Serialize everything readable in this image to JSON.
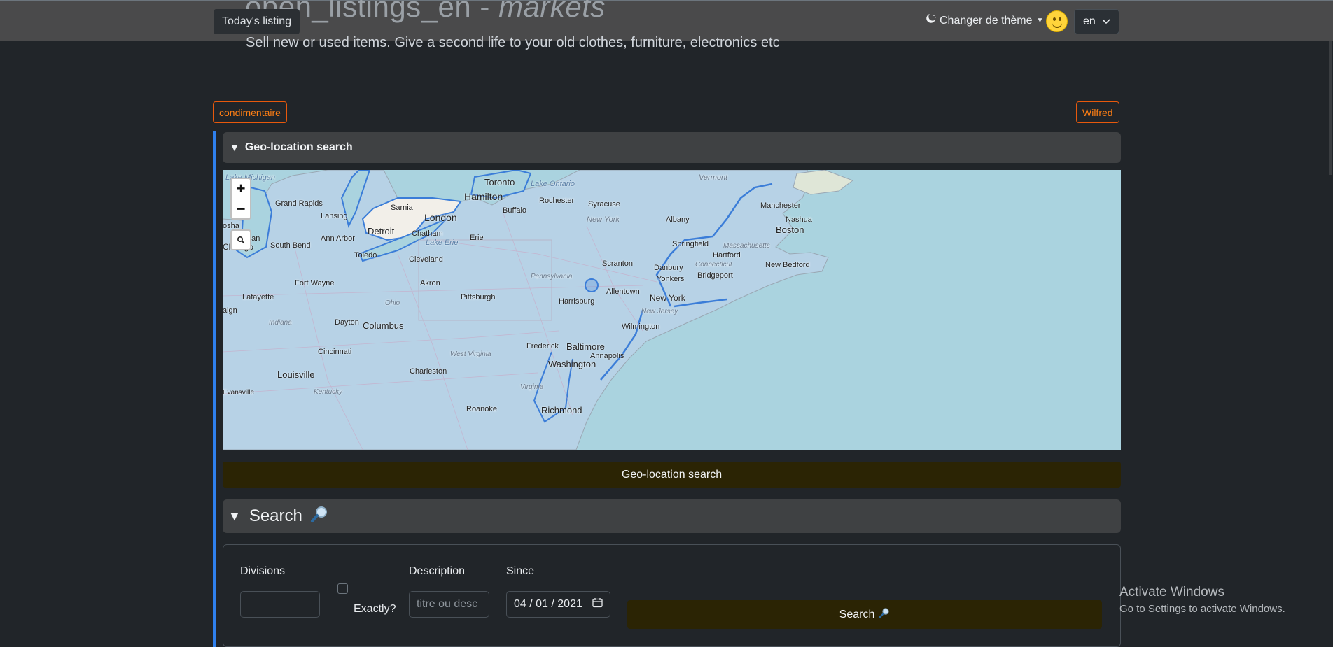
{
  "header": {
    "site_title_main": "open_listings_en - ",
    "site_title_italic": "markets",
    "todays_listing": "Today's listing",
    "theme_switch_label": "Changer de thème",
    "language": "en",
    "subtitle": "Sell new or used items. Give a second life to your old clothes, furniture, electronics etc"
  },
  "tags": {
    "left": "condimentaire",
    "right": "Wilfred"
  },
  "geo": {
    "section_title": "Geo-location search",
    "button_label": "Geo-location search",
    "map": {
      "zoom_in": "+",
      "zoom_out": "−",
      "labels": {
        "lake_michigan": "Lake Michigan",
        "toronto": "Toronto",
        "lake_ontario": "Lake Ontario",
        "vermont": "Vermont",
        "hamilton": "Hamilton",
        "rochester": "Rochester",
        "syracuse": "Syracuse",
        "manchester": "Manchester",
        "nashua": "Nashua",
        "grand_rapids": "Grand Rapids",
        "sarnia": "Sarnia",
        "lansing": "Lansing",
        "london": "London",
        "buffalo": "Buffalo",
        "new_york_state": "New York",
        "albany": "Albany",
        "boston": "Boston",
        "detroit": "Detroit",
        "chatham": "Chatham",
        "ann_arbor": "Ann Arbor",
        "erie": "Erie",
        "lake_erie": "Lake Erie",
        "springfield": "Springfield",
        "massachusetts": "Massachusetts",
        "chicago": "Chicago",
        "south_bend": "South Bend",
        "toledo": "Toledo",
        "cleveland": "Cleveland",
        "scranton": "Scranton",
        "hartford": "Hartford",
        "connecticut": "Connecticut",
        "new_bedford": "New Bedford",
        "danbury": "Danbury",
        "pennsylvania": "Pennsylvania",
        "fort_wayne": "Fort Wayne",
        "akron": "Akron",
        "yonkers": "Yonkers",
        "bridgeport": "Bridgeport",
        "lafayette": "Lafayette",
        "ohio": "Ohio",
        "pittsburgh": "Pittsburgh",
        "harrisburg": "Harrisburg",
        "allentown": "Allentown",
        "new_york_city": "New York",
        "dayton": "Dayton",
        "columbus": "Columbus",
        "indiana": "Indiana",
        "new_jersey": "New Jersey",
        "wilmington": "Wilmington",
        "frederick": "Frederick",
        "baltimore": "Baltimore",
        "cincinnati": "Cincinnati",
        "west_virginia": "West Virginia",
        "annapolis": "Annapolis",
        "washington": "Washington",
        "louisville": "Louisville",
        "charleston": "Charleston",
        "kentucky": "Kentucky",
        "virginia": "Virginia",
        "evansville": "Evansville",
        "roanoke": "Roanoke",
        "richmond": "Richmond",
        "gan": "gan",
        "osha": "osha",
        "aign": "aign"
      }
    }
  },
  "search": {
    "section_title": "Search",
    "divisions_label": "Divisions",
    "divisions_value": "",
    "exactly_label": "Exactly?",
    "description_label": "Description",
    "description_placeholder": "titre ou desc",
    "since_label": "Since",
    "since_value": "04 / 01 / 2021",
    "button_label": "Search"
  },
  "watermark": {
    "line1": "Activate Windows",
    "line2": "Go to Settings to activate Windows."
  },
  "colors": {
    "background": "#212529",
    "topbar": "#4a4a4b",
    "accent_blue": "#2f80ed",
    "tag_orange": "#fd7e14",
    "button_dark": "#2b2404",
    "water": "#aad3df",
    "land": "#b7d2e6"
  },
  "icons": {
    "theme": "moon-stars-icon",
    "smiley": "smiley-face-icon",
    "lang_caret": "chevron-down-icon",
    "search": "magnifier-icon",
    "calendar": "calendar-icon",
    "map_search": "search-icon"
  }
}
